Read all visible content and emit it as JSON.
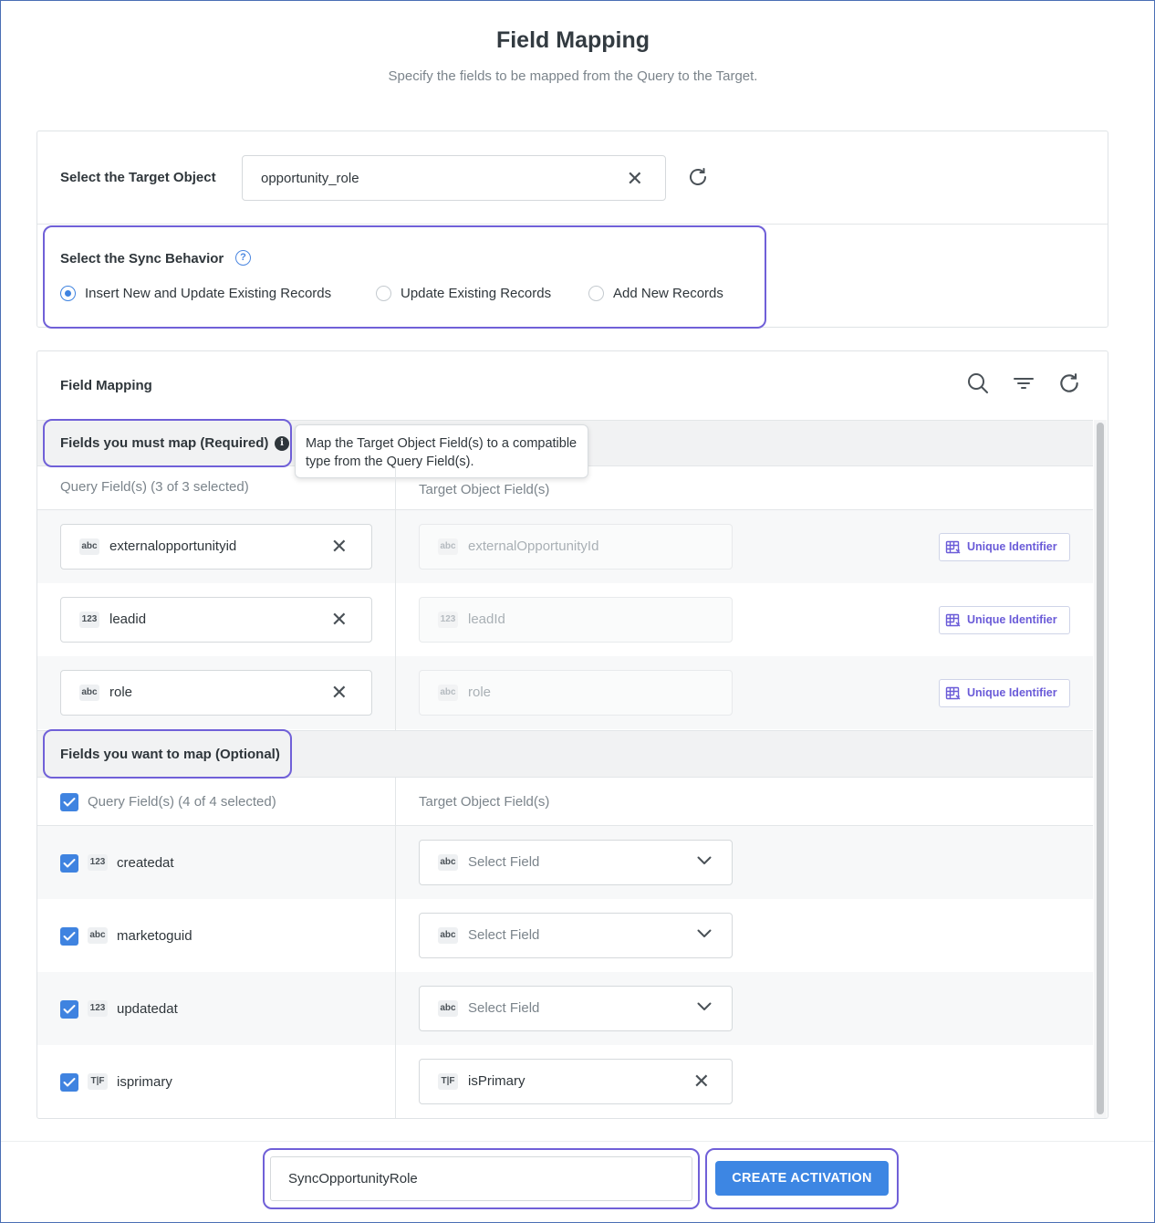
{
  "header": {
    "title": "Field Mapping",
    "subtitle": "Specify the fields to be mapped from the Query to the Target."
  },
  "target": {
    "label": "Select the Target Object",
    "value": "opportunity_role"
  },
  "sync": {
    "label": "Select the Sync Behavior",
    "options": [
      {
        "label": "Insert New and Update Existing Records",
        "selected": true
      },
      {
        "label": "Update Existing Records",
        "selected": false
      },
      {
        "label": "Add New Records",
        "selected": false
      }
    ]
  },
  "mapping": {
    "title": "Field Mapping",
    "required": {
      "label": "Fields you must map (Required)",
      "tooltip": "Map the Target Object Field(s) to a compatible type from the Query Field(s).",
      "query_header": "Query Field(s) (3 of 3 selected)",
      "target_header": "Target Object Field(s)",
      "rows": [
        {
          "type": "abc",
          "query": "externalopportunityid",
          "target_type": "abc",
          "target": "externalOpportunityId",
          "badge": "Unique Identifier"
        },
        {
          "type": "123",
          "query": "leadid",
          "target_type": "123",
          "target": "leadId",
          "badge": "Unique Identifier"
        },
        {
          "type": "abc",
          "query": "role",
          "target_type": "abc",
          "target": "role",
          "badge": "Unique Identifier"
        }
      ]
    },
    "optional": {
      "label": "Fields you want to map (Optional)",
      "query_header": "Query Field(s) (4 of 4 selected)",
      "target_header": "Target Object Field(s)",
      "rows": [
        {
          "type": "123",
          "query": "createdat",
          "target_type": "abc",
          "target": "Select Field",
          "checked": true
        },
        {
          "type": "abc",
          "query": "marketoguid",
          "target_type": "abc",
          "target": "Select Field",
          "checked": true
        },
        {
          "type": "123",
          "query": "updatedat",
          "target_type": "abc",
          "target": "Select Field",
          "checked": true
        },
        {
          "type": "T|F",
          "query": "isprimary",
          "target_type": "T|F",
          "target": "isPrimary",
          "checked": true
        }
      ]
    }
  },
  "footer": {
    "activation_name": "SyncOpportunityRole",
    "create_label": "CREATE ACTIVATION"
  },
  "colors": {
    "accent": "#3d86e3",
    "highlight": "#7060d8"
  }
}
